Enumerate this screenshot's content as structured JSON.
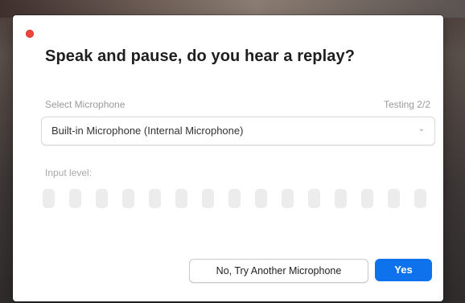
{
  "dialog": {
    "title": "Speak and pause, do you hear a replay?",
    "microphone_label": "Select Microphone",
    "testing_status": "Testing 2/2",
    "microphone_select": {
      "selected": "Built-in Microphone (Internal Microphone)",
      "caret": "⌄"
    },
    "input_level_label": "Input level:",
    "input_level": {
      "segments": 15,
      "active_segments": 0
    },
    "buttons": {
      "secondary": "No, Try Another Microphone",
      "primary": "Yes"
    }
  },
  "colors": {
    "primary_button": "#0e72ed",
    "close_button": "#f0453b",
    "meter_inactive": "#ececec"
  },
  "icons": {
    "close": "close-dot-icon",
    "dropdown": "chevron-down-icon"
  }
}
